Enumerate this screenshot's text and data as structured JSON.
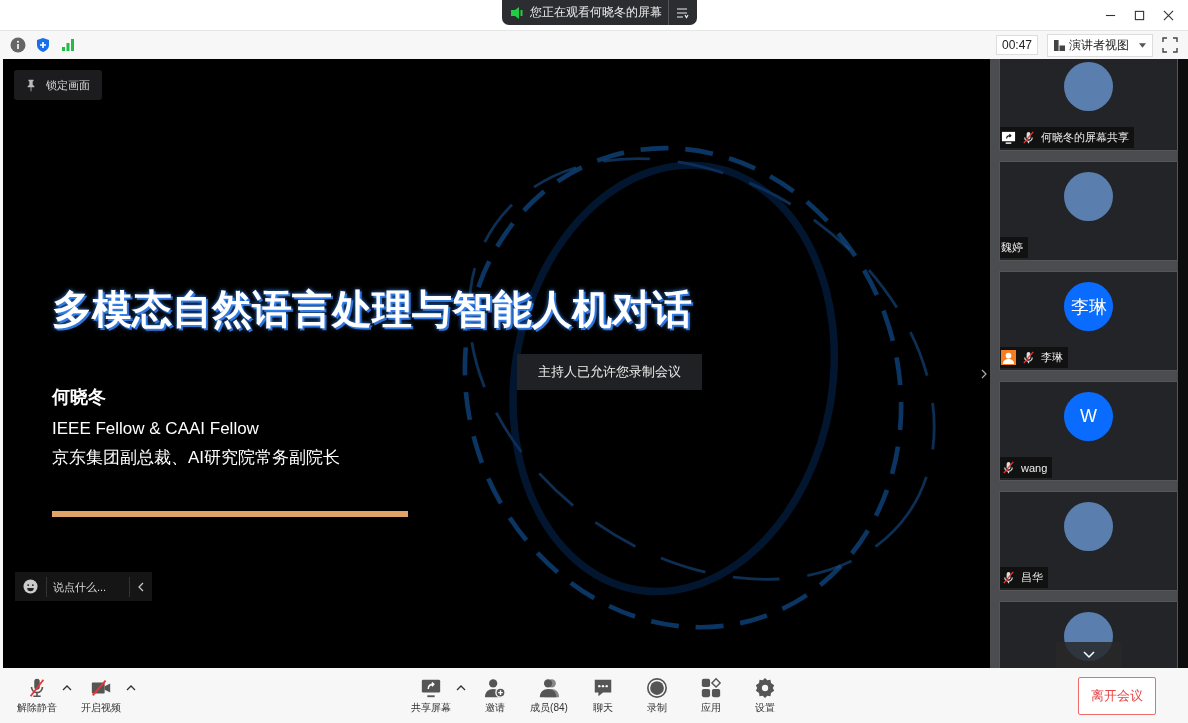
{
  "window": {
    "sharing_notice": "您正在观看何晓冬的屏幕"
  },
  "info_bar": {
    "timer": "00:47",
    "view_mode": "演讲者视图"
  },
  "lock_button": "锁定画面",
  "slide": {
    "title": "多模态自然语言处理与智能人机对话",
    "speaker": "何晓冬",
    "lines": [
      "IEEE Fellow & CAAI Fellow",
      "京东集团副总裁、AI研究院常务副院长"
    ]
  },
  "toast": "主持人已允许您录制会议",
  "chat_input": {
    "placeholder": "说点什么..."
  },
  "participants": [
    {
      "name": "何晓冬的屏幕共享",
      "kind": "photo",
      "badges": [
        {
          "kind": "screen"
        }
      ],
      "mic_off": true
    },
    {
      "name": "魏婷",
      "kind": "photo",
      "mic_off": false
    },
    {
      "name": "李琳",
      "kind": "initials",
      "initials": "李琳",
      "badges": [
        {
          "kind": "person"
        }
      ],
      "mic_off": true
    },
    {
      "name": "wang",
      "kind": "initials",
      "initials": "W",
      "mic_off": true
    },
    {
      "name": "昌华",
      "kind": "photo",
      "mic_off": true
    },
    {
      "kind": "photo",
      "mic_off": false
    }
  ],
  "toolbar": [
    {
      "kind": "mic-off",
      "label": "解除静音",
      "menu": true
    },
    {
      "kind": "video-off",
      "label": "开启视频",
      "menu": true
    },
    {
      "kind": "share",
      "label": "共享屏幕",
      "menu": true
    },
    {
      "kind": "invite",
      "label": "邀请",
      "menu": false
    },
    {
      "kind": "members",
      "label": "成员(84)",
      "menu": false
    },
    {
      "kind": "chat",
      "label": "聊天",
      "menu": false
    },
    {
      "kind": "record",
      "label": "录制",
      "menu": false
    },
    {
      "kind": "apps",
      "label": "应用",
      "menu": false
    },
    {
      "kind": "settings",
      "label": "设置",
      "menu": false
    }
  ],
  "leave_button": "离开会议"
}
